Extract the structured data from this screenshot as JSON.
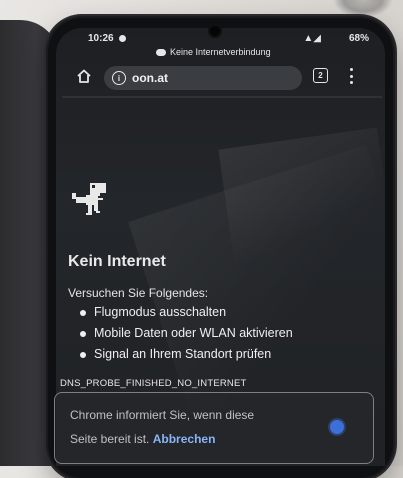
{
  "status_bar": {
    "time": "10:26",
    "battery": "68%",
    "signal": "4G"
  },
  "offline_banner": "Keine Internetverbindung",
  "toolbar": {
    "url": "oon.at",
    "tab_count": "2"
  },
  "page": {
    "title": "Kein Internet",
    "subtitle": "Versuchen Sie Folgendes:",
    "suggestions": [
      "Flugmodus ausschalten",
      "Mobile Daten oder WLAN aktivieren",
      "Signal an Ihrem Standort prüfen"
    ],
    "error_code": "DNS_PROBE_FINISHED_NO_INTERNET"
  },
  "notice_card": {
    "line1": "Chrome informiert Sie, wenn diese",
    "line2_prefix": "Seite bereit ist.",
    "cancel_link": "Abbrechen"
  },
  "icons": {
    "home": "home-icon",
    "info": "info-icon",
    "tabs": "tabs-icon",
    "menu": "more-vert-icon",
    "dino": "dino-icon"
  },
  "colors": {
    "link": "#8ab4f8",
    "screen_bg": "#202225",
    "accent_blue": "#3d6fd9"
  }
}
